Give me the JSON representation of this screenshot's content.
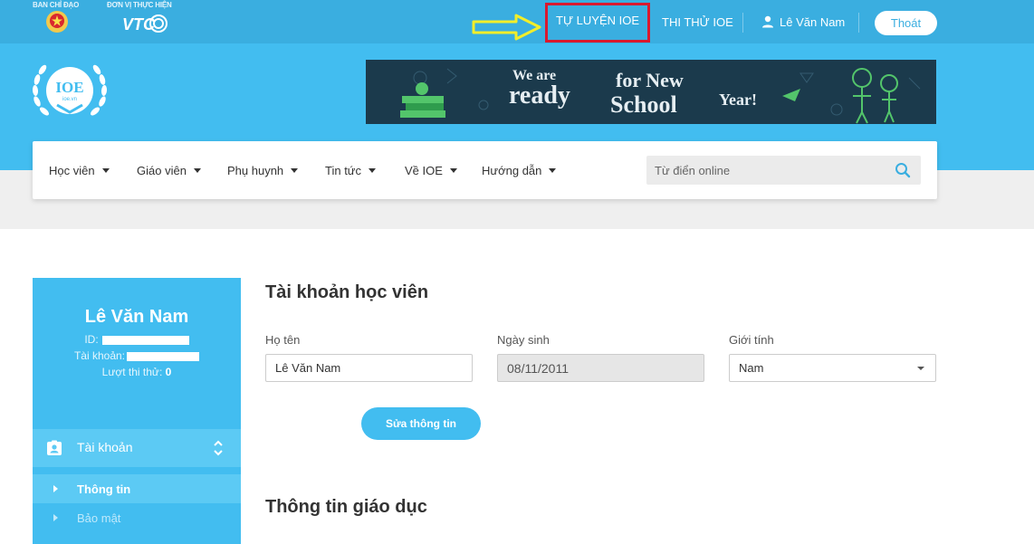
{
  "topbar": {
    "org_steering": "BAN CHỈ ĐẠO",
    "org_executor": "ĐƠN VỊ THỰC HIỆN",
    "practice_label": "TỰ LUYỆN IOE",
    "test_label": "THI THỬ IOE",
    "user_name": "Lê Văn Nam",
    "logout_label": "Thoát",
    "colors": {
      "bar": "#3aaee0",
      "highlight": "#d9192f",
      "arrow": "#f2ee2a"
    }
  },
  "header": {
    "logo_text": "IOE",
    "logo_sub": "ioe.vn",
    "banner": {
      "line1": "We are",
      "line2": "ready",
      "line3": "for New",
      "line4": "School",
      "line5": "Year!"
    }
  },
  "nav": {
    "items": [
      {
        "label": "Học viên"
      },
      {
        "label": "Giáo viên"
      },
      {
        "label": "Phụ huynh"
      },
      {
        "label": "Tin tức"
      },
      {
        "label": "Về IOE"
      },
      {
        "label": "Hướng dẫn"
      }
    ],
    "search_placeholder": "Từ điển online"
  },
  "sidebar": {
    "name": "Lê Văn Nam",
    "id_label": "ID:",
    "account_label": "Tài khoản:",
    "tries_label": "Lượt thi thử:",
    "tries_value": "0",
    "section_label": "Tài khoản",
    "sub_items": [
      {
        "label": "Thông tin",
        "active": true
      },
      {
        "label": "Bảo mật",
        "active": false
      }
    ]
  },
  "main": {
    "title": "Tài khoản học viên",
    "fields": {
      "name_label": "Họ tên",
      "name_value": "Lê Văn Nam",
      "dob_label": "Ngày sinh",
      "dob_value": "08/11/2011",
      "gender_label": "Giới tính",
      "gender_value": "Nam"
    },
    "edit_button": "Sửa thông tin",
    "section2_title": "Thông tin giáo dục"
  }
}
